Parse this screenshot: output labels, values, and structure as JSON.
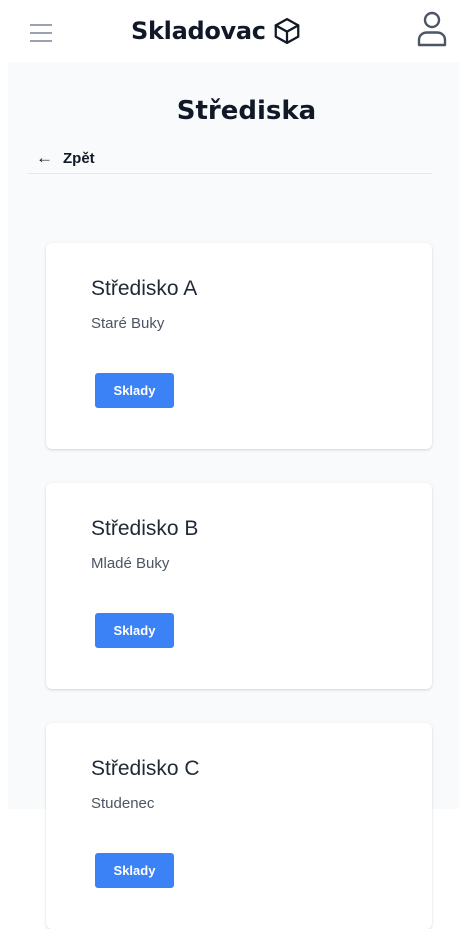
{
  "header": {
    "brand": "Skladovac",
    "icons": {
      "menu": "hamburger-menu-icon",
      "brand": "cube-icon",
      "user": "user-icon"
    }
  },
  "page": {
    "title": "Střediska",
    "back_label": "Zpět"
  },
  "centers": [
    {
      "name": "Středisko A",
      "location": "Staré Buky",
      "button_label": "Sklady"
    },
    {
      "name": "Středisko B",
      "location": "Mladé Buky",
      "button_label": "Sklady"
    },
    {
      "name": "Středisko C",
      "location": "Studenec",
      "button_label": "Sklady"
    }
  ],
  "colors": {
    "primary_button": "#3b82f6",
    "page_background": "#f9fafb",
    "card_background": "#ffffff",
    "text_dark": "#111827"
  }
}
